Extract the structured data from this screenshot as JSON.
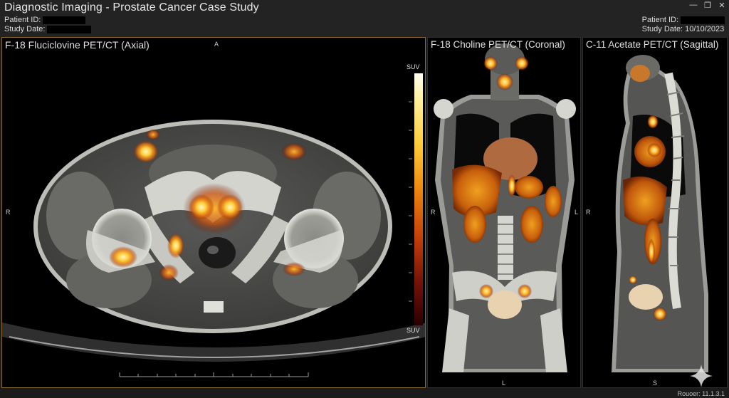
{
  "app": {
    "title": "Diagnostic Imaging - Prostate Cancer Case Study"
  },
  "header_left": {
    "patient_id_label": "Patient ID:",
    "study_date_label": "Study Date:"
  },
  "header_right": {
    "patient_id_label": "Patient ID:",
    "study_date": "Study Date: 10/10/2023"
  },
  "viewports": {
    "axial": {
      "title": "F-18 Fluciclovine PET/CT (Axial)",
      "top": "A",
      "right_side": "R",
      "scale_top": "SUV",
      "scale_bottom": "SUV"
    },
    "coronal": {
      "title": "F-18 Choline PET/CT (Coronal)",
      "left_side": "R",
      "right_side": "L",
      "bottom": "L"
    },
    "sagittal": {
      "title": "C-11 Acetate PET/CT (Sagittal)",
      "left_side": "R",
      "bottom": "S"
    }
  },
  "footer": {
    "version": "Rouoer: 11.1.3.1"
  },
  "colors": {
    "accent_border": "#8a6a2c",
    "uptake_hot": "#ffd34a",
    "uptake_warm": "#e06a10"
  },
  "icons": [
    "minimize-icon",
    "restore-icon",
    "close-icon",
    "sparkle-icon"
  ]
}
